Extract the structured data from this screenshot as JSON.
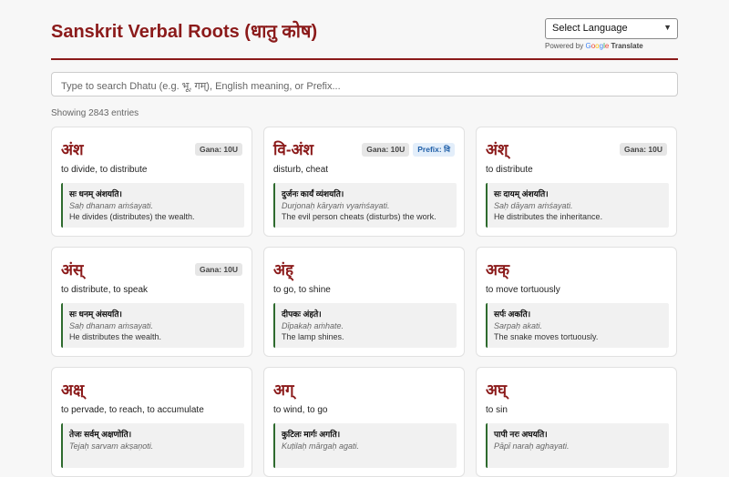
{
  "header": {
    "title": "Sanskrit Verbal Roots (धातु कोष)",
    "language_select": "Select Language",
    "powered_by": "Powered by",
    "google_letters": [
      "G",
      "o",
      "o",
      "g",
      "l",
      "e"
    ],
    "translate": "Translate"
  },
  "search": {
    "placeholder": "Type to search Dhatu (e.g. भू, गम्), English meaning, or Prefix..."
  },
  "results": {
    "count_text": "Showing 2843 entries"
  },
  "entries": [
    {
      "root": "अंश",
      "gana": "Gana: 10U",
      "prefix": "",
      "meaning": "to divide, to distribute",
      "example_devanagari": "सः धनम् अंशयति।",
      "example_transliteration": "Saḥ dhanam aṁśayati.",
      "example_english": "He divides (distributes) the wealth."
    },
    {
      "root": "वि-अंश",
      "gana": "Gana: 10U",
      "prefix": "Prefix: वि",
      "meaning": "disturb, cheat",
      "example_devanagari": "दुर्जनः कार्यं व्यंशयति।",
      "example_transliteration": "Durjonaḥ kāryaṁ vyaṁśayati.",
      "example_english": "The evil person cheats (disturbs) the work."
    },
    {
      "root": "अंश्",
      "gana": "Gana: 10U",
      "prefix": "",
      "meaning": "to distribute",
      "example_devanagari": "सः दायम् अंशयति।",
      "example_transliteration": "Saḥ dāyam aṁśayati.",
      "example_english": "He distributes the inheritance."
    },
    {
      "root": "अंस्",
      "gana": "Gana: 10U",
      "prefix": "",
      "meaning": "to distribute, to speak",
      "example_devanagari": "सः धनम् अंसयति।",
      "example_transliteration": "Saḥ dhanam aṁsayati.",
      "example_english": "He distributes the wealth."
    },
    {
      "root": "अंह्",
      "gana": "",
      "prefix": "",
      "meaning": "to go, to shine",
      "example_devanagari": "दीपकः अंहते।",
      "example_transliteration": "Dīpakaḥ aṁhate.",
      "example_english": "The lamp shines."
    },
    {
      "root": "अक्",
      "gana": "",
      "prefix": "",
      "meaning": "to move tortuously",
      "example_devanagari": "सर्पः अकति।",
      "example_transliteration": "Sarpaḥ akati.",
      "example_english": "The snake moves tortuously."
    },
    {
      "root": "अक्ष्",
      "gana": "",
      "prefix": "",
      "meaning": "to pervade, to reach, to accumulate",
      "example_devanagari": "तेजः सर्वम् अक्षणोति।",
      "example_transliteration": "Tejaḥ sarvam akṣaṇoti.",
      "example_english": ""
    },
    {
      "root": "अग्",
      "gana": "",
      "prefix": "",
      "meaning": "to wind, to go",
      "example_devanagari": "कुटिलः मार्गः अगति।",
      "example_transliteration": "Kuṭilaḥ mārgaḥ agati.",
      "example_english": ""
    },
    {
      "root": "अघ्",
      "gana": "",
      "prefix": "",
      "meaning": "to sin",
      "example_devanagari": "पापी नरः अघयति।",
      "example_transliteration": "Pāpī naraḥ aghayati.",
      "example_english": ""
    }
  ],
  "colors": {
    "accent": "#8b1a1a",
    "example_border": "#2e6b2e",
    "prefix_text": "#1f5fa8"
  }
}
